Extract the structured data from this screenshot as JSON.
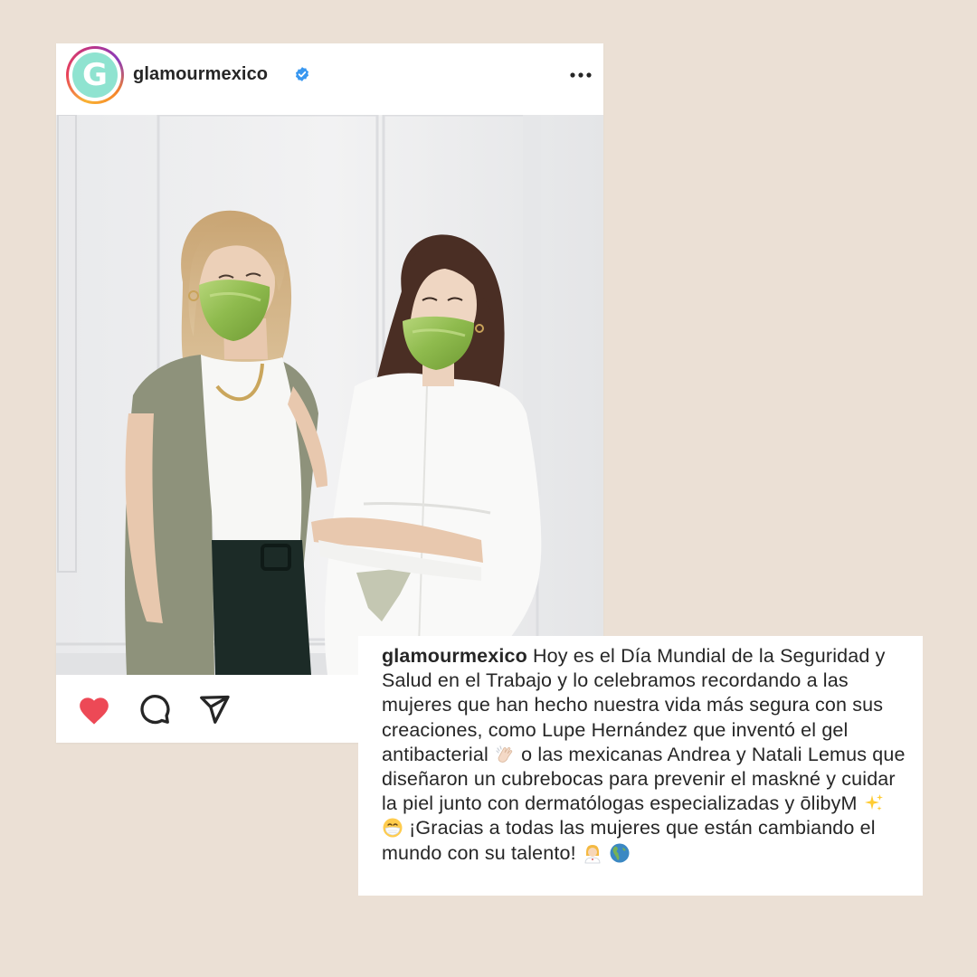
{
  "post": {
    "username": "glamourmexico",
    "avatar_letter": "G",
    "verified": true,
    "icons": {
      "verified": "verified-badge-icon",
      "more": "more-options-icon",
      "like": "heart-icon",
      "comment": "comment-bubble-icon",
      "share": "paper-plane-icon"
    },
    "like_color": "#ed4956",
    "photo": "two women wearing green satin face masks against a white paneled wall"
  },
  "caption": {
    "username": "glamourmexico",
    "text_part_1": " Hoy es el Día Mundial de la Seguridad y Salud en el Trabajo y lo celebramos recordando a las mujeres que han hecho nuestra vida más segura con sus creaciones, como Lupe Hernández que inventó el gel antibacterial ",
    "text_part_2": " o las mexicanas Andrea y Natali Lemus que diseñaron un cubrebocas para prevenir el maskné y cuidar la piel junto con dermatólogas especializadas y ōlibyM ",
    "text_part_3": " ¡Gracias a todas las mujeres que están cambiando el mundo con su talento! ",
    "emojis": [
      "clapping-hands-emoji",
      "sparkles-emoji",
      "face-with-medical-mask-emoji",
      "woman-health-worker-emoji",
      "globe-americas-emoji"
    ]
  },
  "colors": {
    "background": "#ebe0d5",
    "card": "#ffffff",
    "text": "#262626",
    "verified_blue": "#3897f0"
  }
}
